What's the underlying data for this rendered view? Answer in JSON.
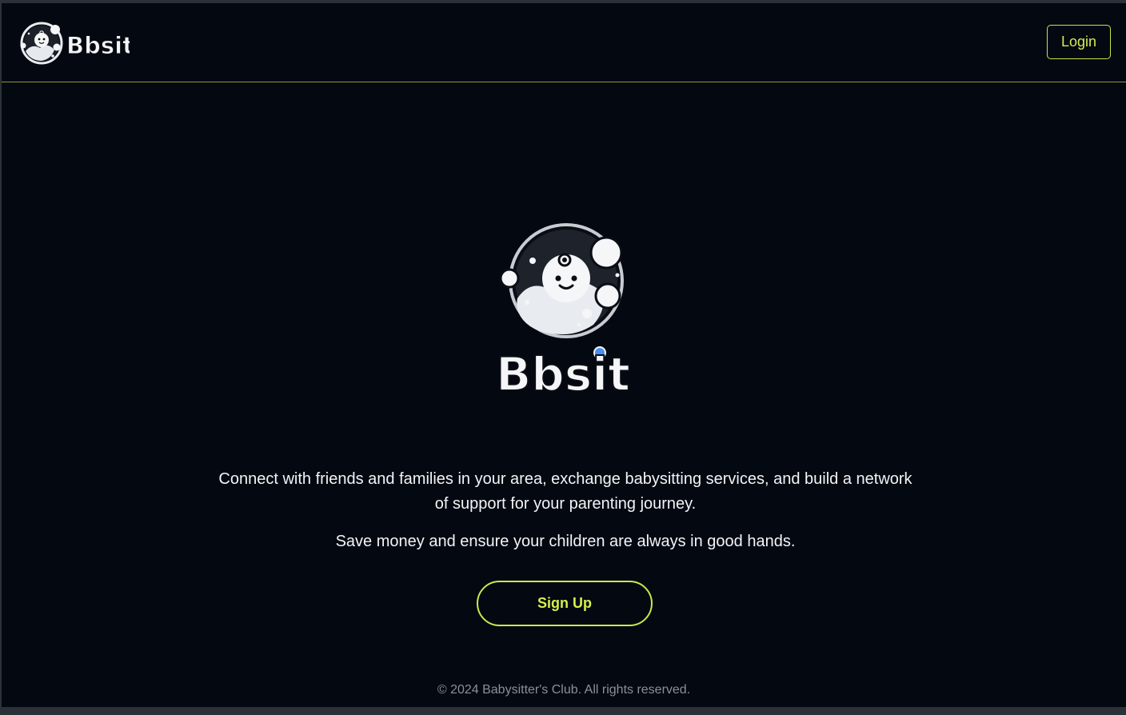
{
  "header": {
    "brand_name": "Bbsit",
    "login_label": "Login"
  },
  "hero": {
    "brand_name": "Bbsit",
    "tagline_main": "Connect with friends and families in your area, exchange babysitting services, and build a network of support for your parenting journey.",
    "tagline_secondary": "Save money and ensure your children are always in good hands.",
    "signup_label": "Sign Up"
  },
  "footer": {
    "copyright": "© 2024 Babysitter's Club. All rights reserved."
  },
  "colors": {
    "background": "#040811",
    "accent": "#d4ef4c",
    "text": "#f2f4f6",
    "muted": "#8b9098"
  },
  "icons": {
    "brand_mascot": "baby-face-bubble-icon"
  }
}
